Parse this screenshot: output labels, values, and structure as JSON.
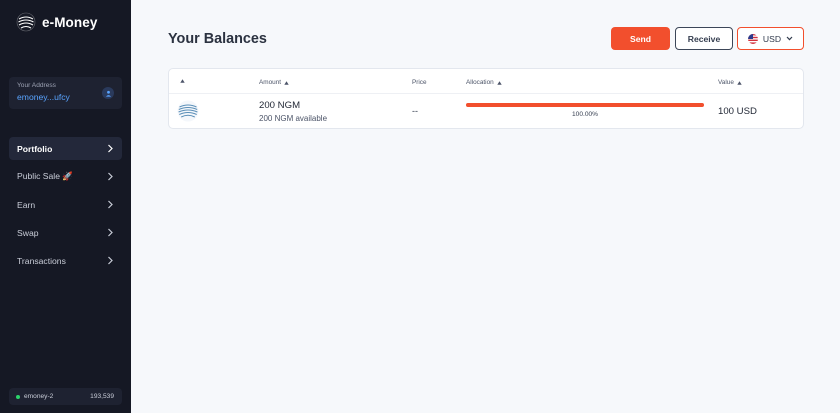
{
  "app": {
    "name": "e-Money"
  },
  "sidebar": {
    "address_label": "Your Address",
    "address_value": "emoney...ufcy",
    "items": [
      {
        "label": "Portfolio",
        "active": true
      },
      {
        "label": "Public Sale 🚀",
        "active": false
      },
      {
        "label": "Earn",
        "active": false
      },
      {
        "label": "Swap",
        "active": false
      },
      {
        "label": "Transactions",
        "active": false
      }
    ],
    "footer": {
      "chain_id": "emoney-2",
      "block_height": "193,539"
    }
  },
  "main": {
    "title": "Your Balances",
    "buttons": {
      "send": "Send",
      "receive": "Receive",
      "currency": "USD"
    },
    "table": {
      "headers": {
        "token": "",
        "amount": "Amount",
        "price": "Price",
        "allocation": "Allocation",
        "value": "Value"
      },
      "rows": [
        {
          "amount": "200 NGM",
          "available": "200 NGM available",
          "price": "--",
          "allocation": "100.00%",
          "allocation_fraction": 1.0,
          "value": "100 USD"
        }
      ]
    }
  },
  "colors": {
    "accent": "#f24f2d",
    "sidebar_bg": "#151824",
    "address_link": "#59a4ff",
    "status_online": "#2bd36b"
  }
}
